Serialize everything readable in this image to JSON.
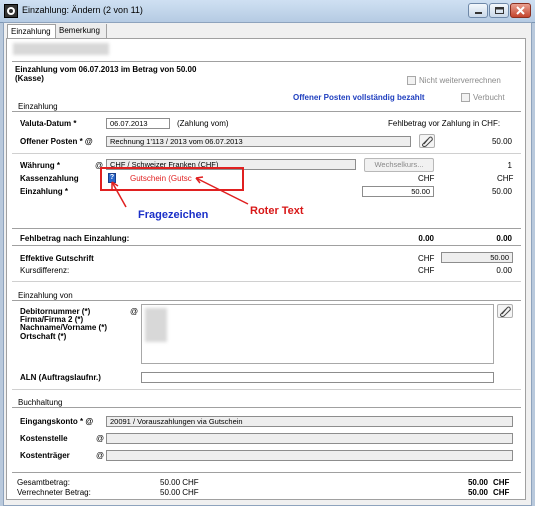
{
  "window": {
    "title": "Einzahlung: Ändern (2 von 11)"
  },
  "tabs": [
    {
      "label": "Einzahlung"
    },
    {
      "label": "Bemerkung"
    }
  ],
  "header": {
    "line1": "Einzahlung vom 06.07.2013 im Betrag von 50.00",
    "line2": "(Kasse)",
    "nicht_weiterverrechnen": "Nicht weiterverrechnen",
    "op_bezahlt": "Offener Posten vollständig bezahlt",
    "verbucht": "Verbucht"
  },
  "einzahlung": {
    "section": "Einzahlung",
    "valuta_label": "Valuta-Datum *",
    "valuta_value": "06.07.2013",
    "valuta_hint": "(Zahlung vom)",
    "fehlbetrag_vor": "Fehlbetrag vor Zahlung in CHF:",
    "op_label": "Offener Posten * @",
    "op_value": "Rechnung 1'113 / 2013 vom 06.07.2013",
    "op_amount": "50.00",
    "waehrung_label": "Währung *",
    "waehrung_at": "@",
    "waehrung_value": "CHF / Schweizer Franken (CHF)",
    "wechselkurs_btn": "Wechselkurs...",
    "kurs_value": "1",
    "kasse_label": "Kassenzahlung",
    "kasse_value": "Gutschein (Gutsc",
    "kasse_chf1": "CHF",
    "kasse_chf2": "CHF",
    "einz_label": "Einzahlung *",
    "einz_value": "50.00",
    "einz_amount": "50.00"
  },
  "annotations": {
    "fragezeichen": "Fragezeichen",
    "roter_text": "Roter Text"
  },
  "fehlbetrag": {
    "label": "Fehlbetrag nach Einzahlung:",
    "v1": "0.00",
    "v2": "0.00"
  },
  "gutschrift": {
    "label": "Effektive Gutschrift",
    "chf": "CHF",
    "value": "50.00",
    "kurs_label": "Kursdifferenz:",
    "kurs_chf": "CHF",
    "kurs_value": "0.00"
  },
  "von": {
    "section": "Einzahlung von",
    "line1": "Debitornummer (*)",
    "line2": "Firma/Firma 2 (*)",
    "line3": "Nachname/Vorname (*)",
    "line4": "Ortschaft (*)",
    "at": "@",
    "aln_label": "ALN (Auftragslaufnr.)"
  },
  "buchhaltung": {
    "section": "Buchhaltung",
    "konto_label": "Eingangskonto * @",
    "konto_value": "20091 / Vorauszahlungen via Gutschein",
    "kst_label": "Kostenstelle",
    "ktr_label": "Kostenträger",
    "at": "@"
  },
  "footer": {
    "gesamt_label": "Gesamtbetrag:",
    "gesamt_value": "50.00  CHF",
    "gesamt_right": "50.00",
    "gesamt_chf": "CHF",
    "verr_label": "Verrechneter Betrag:",
    "verr_value": "50.00  CHF",
    "verr_right": "50.00",
    "verr_chf": "CHF"
  },
  "colors": {
    "accent_blue": "#1a2fc8",
    "annotation_red": "#e02020",
    "link_blue": "#1f3fbf"
  }
}
